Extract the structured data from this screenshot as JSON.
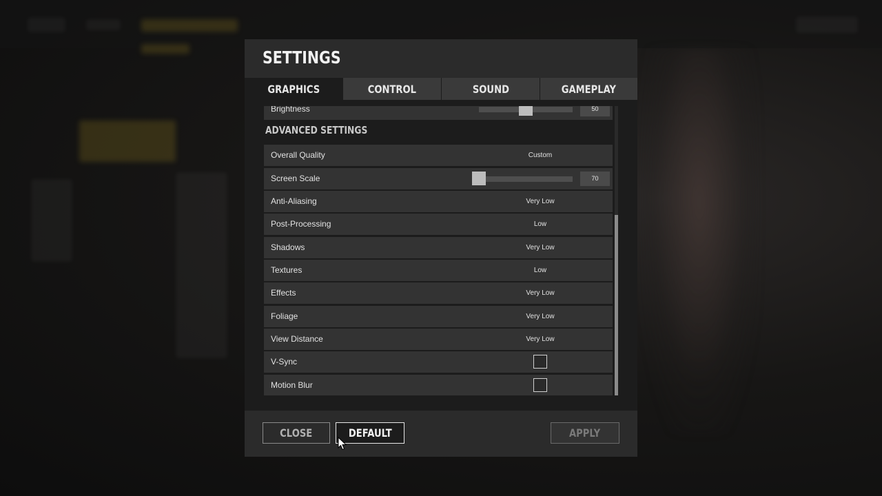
{
  "window": {
    "title": "SETTINGS"
  },
  "tabs": [
    {
      "label": "GRAPHICS",
      "active": true
    },
    {
      "label": "CONTROL",
      "active": false
    },
    {
      "label": "SOUND",
      "active": false
    },
    {
      "label": "GAMEPLAY",
      "active": false
    }
  ],
  "brightness": {
    "label": "Brightness",
    "value": "50",
    "level": 0.5
  },
  "advanced": {
    "title": "ADVANCED SETTINGS",
    "overall_quality": {
      "label": "Overall Quality",
      "value": "Custom"
    },
    "screen_scale": {
      "label": "Screen Scale",
      "value": "70",
      "level": 0.0
    },
    "anti_aliasing": {
      "label": "Anti-Aliasing",
      "value": "Very Low"
    },
    "post_processing": {
      "label": "Post-Processing",
      "value": "Low"
    },
    "shadows": {
      "label": "Shadows",
      "value": "Very Low"
    },
    "textures": {
      "label": "Textures",
      "value": "Low"
    },
    "effects": {
      "label": "Effects",
      "value": "Very Low"
    },
    "foliage": {
      "label": "Foliage",
      "value": "Very Low"
    },
    "view_distance": {
      "label": "View Distance",
      "value": "Very Low"
    },
    "vsync": {
      "label": "V-Sync",
      "checked": false
    },
    "motion_blur": {
      "label": "Motion Blur",
      "checked": false
    }
  },
  "footer": {
    "close_label": "CLOSE",
    "default_label": "DEFAULT",
    "apply_label": "APPLY"
  },
  "colors": {
    "panel_bg": "#1c1c1c",
    "header_bg": "#2b2b2b",
    "row_bg": "#333333",
    "text": "#e2e2e2"
  }
}
